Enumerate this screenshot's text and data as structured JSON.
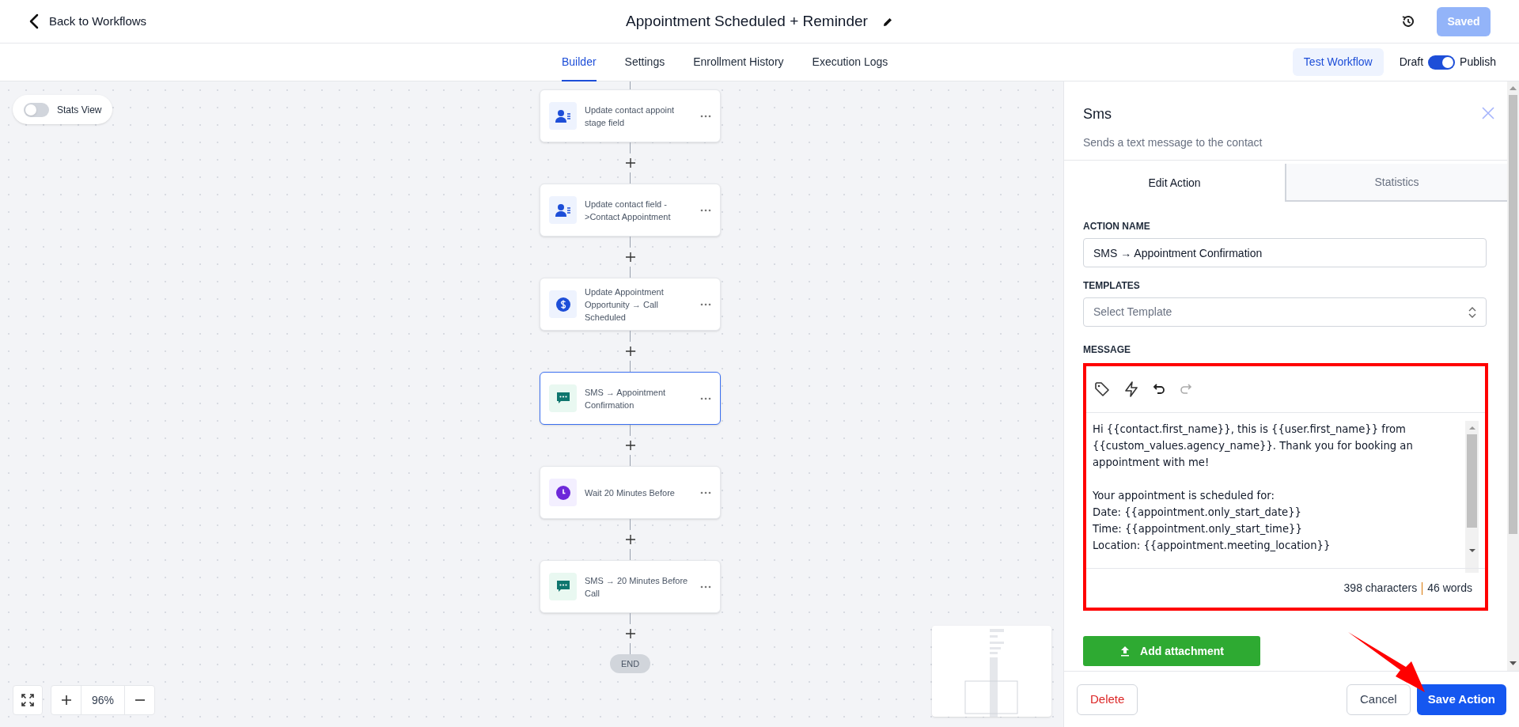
{
  "top_bar": {
    "back_label": "Back to Workflows",
    "title": "Appointment Scheduled + Reminder",
    "saved_button": "Saved"
  },
  "nav_tabs": [
    {
      "label": "Builder",
      "selected": true
    },
    {
      "label": "Settings",
      "selected": false
    },
    {
      "label": "Enrollment History",
      "selected": false
    },
    {
      "label": "Execution Logs",
      "selected": false
    }
  ],
  "test_button": "Test Workflow",
  "publish_toggle": {
    "off_label": "Draft",
    "on_label": "Publish",
    "on": true
  },
  "stats_view": {
    "label": "Stats View",
    "on": false
  },
  "nodes": [
    {
      "label": "Update contact appoint stage field",
      "kind": "contact",
      "selected": false
    },
    {
      "label": "Update contact field ->Contact Appointment",
      "kind": "contact",
      "selected": false
    },
    {
      "label": "Update Appointment Opportunity → Call Scheduled",
      "kind": "opportunity",
      "selected": false
    },
    {
      "label": "SMS → Appointment Confirmation",
      "kind": "sms",
      "selected": true
    },
    {
      "label": "Wait 20 Minutes Before",
      "kind": "wait",
      "selected": false
    },
    {
      "label": "SMS → 20 Minutes Before Call",
      "kind": "sms",
      "selected": false
    }
  ],
  "end_label": "END",
  "zoom": {
    "value": "96%"
  },
  "panel": {
    "title": "Sms",
    "subtitle": "Sends a text message to the contact",
    "tabs": [
      {
        "label": "Edit Action",
        "selected": true
      },
      {
        "label": "Statistics",
        "selected": false
      }
    ],
    "action_name": {
      "label": "ACTION NAME",
      "value": "SMS → Appointment Confirmation"
    },
    "templates": {
      "label": "TEMPLATES",
      "placeholder": "Select Template"
    },
    "message": {
      "label": "MESSAGE",
      "text": "Hi {{contact.first_name}}, this is {{user.first_name}} from {{custom_values.agency_name}}. Thank you for booking an appointment with me!\n\nYour appointment is scheduled for:\nDate: {{appointment.only_start_date}}\nTime: {{appointment.only_start_time}}\nLocation: {{appointment.meeting_location}}",
      "characters": "398 characters",
      "words": "46 words",
      "highlighted": true
    },
    "attachment_button": "Add attachment",
    "buttons": [
      {
        "label": "Delete",
        "kind": "danger"
      },
      {
        "label": "Cancel",
        "kind": "secondary"
      },
      {
        "label": "Save Action",
        "kind": "primary"
      }
    ]
  },
  "annotation_arrow": true
}
